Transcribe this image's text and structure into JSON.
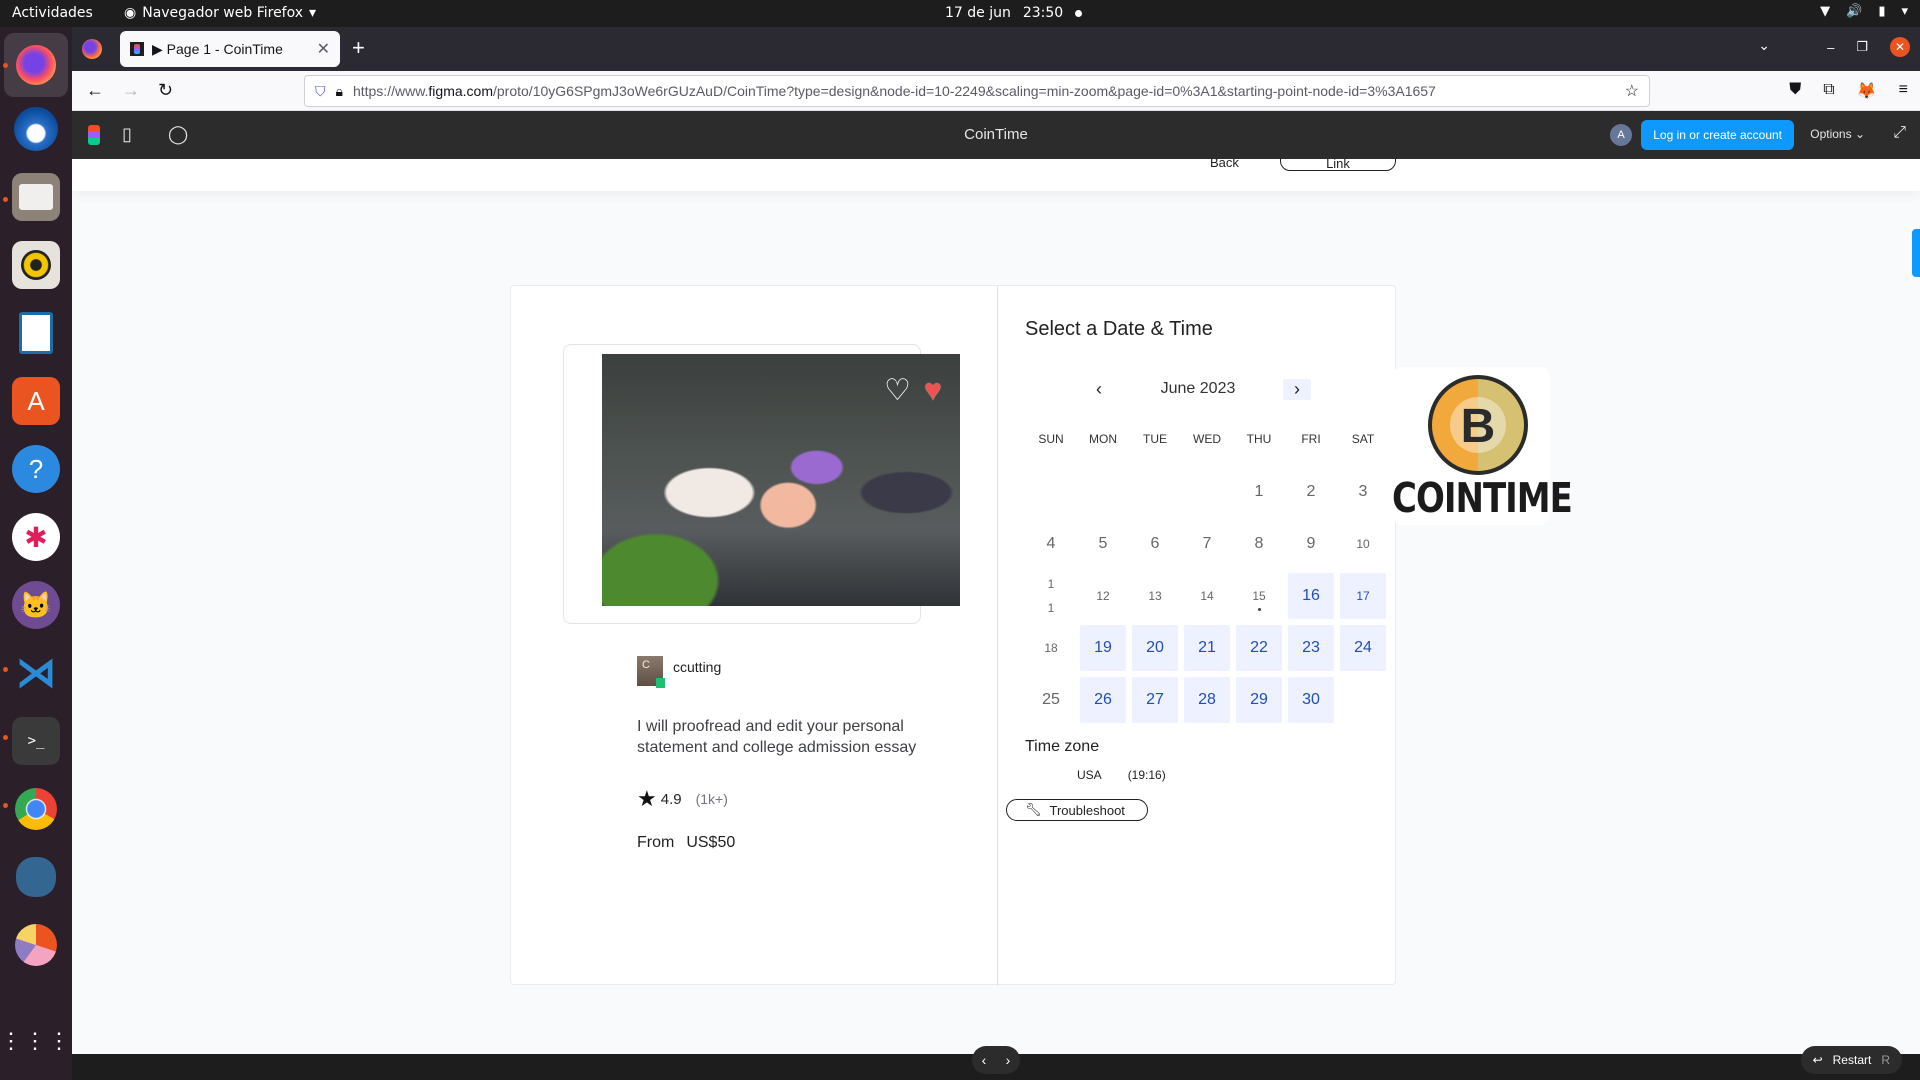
{
  "system": {
    "activities": "Actividades",
    "app_name": "Navegador web Firefox",
    "date": "17 de jun",
    "time": "23:50"
  },
  "dock": {
    "items": [
      "firefox",
      "thunderbird",
      "files",
      "rhythmbox",
      "libreoffice-writer",
      "app-center",
      "help",
      "slack",
      "github-desktop",
      "vscode",
      "terminal",
      "chrome",
      "pgadmin",
      "pie-chart-app",
      "show-apps"
    ]
  },
  "browser": {
    "tab_title": "▶ Page 1 - CoinTime",
    "url_prefix": "https://www.",
    "url_host": "figma.com",
    "url_path": "/proto/10yG6SPgmJ3oWe6rGUzAuD/CoinTime?type=design&node-id=10-2249&scaling=min-zoom&page-id=0%3A1&starting-point-node-id=3%3A1657"
  },
  "figma": {
    "title": "CoinTime",
    "avatar_initial": "A",
    "login_label": "Log in or create account",
    "options_label": "Options ⌄",
    "restart_label": "Restart",
    "restart_key": "R"
  },
  "strip": {
    "back_label": "Back",
    "link_label": "Link"
  },
  "gig": {
    "seller_initial": "C",
    "seller_name": "ccutting",
    "description": "I will proofread and edit your personal statement and college admission essay",
    "rating": "4.9",
    "rating_count": "(1k+)",
    "price_prefix": "From",
    "price": "US$50"
  },
  "calendar": {
    "title": "Select a Date & Time",
    "month": "June 2023",
    "prev_icon": "‹",
    "next_icon": "›",
    "weekdays": [
      "SUN",
      "MON",
      "TUE",
      "WED",
      "THU",
      "FRI",
      "SAT"
    ],
    "weeks": [
      [
        {
          "d": ""
        },
        {
          "d": ""
        },
        {
          "d": ""
        },
        {
          "d": ""
        },
        {
          "d": "1"
        },
        {
          "d": "2"
        },
        {
          "d": "3"
        }
      ],
      [
        {
          "d": "4"
        },
        {
          "d": "5"
        },
        {
          "d": "6"
        },
        {
          "d": "7"
        },
        {
          "d": "8"
        },
        {
          "d": "9"
        },
        {
          "d": "10",
          "small": true
        }
      ],
      [
        {
          "d": "1\n1",
          "small": true
        },
        {
          "d": "12",
          "small": true
        },
        {
          "d": "13",
          "small": true
        },
        {
          "d": "14",
          "small": true
        },
        {
          "d": "15",
          "small": true,
          "today": true
        },
        {
          "d": "16",
          "avail": true
        },
        {
          "d": "17",
          "avail": true,
          "small": true
        }
      ],
      [
        {
          "d": "18",
          "small": true
        },
        {
          "d": "19",
          "avail": true
        },
        {
          "d": "20",
          "avail": true
        },
        {
          "d": "21",
          "avail": true
        },
        {
          "d": "22",
          "avail": true
        },
        {
          "d": "23",
          "avail": true
        },
        {
          "d": "24",
          "avail": true
        }
      ],
      [
        {
          "d": "25"
        },
        {
          "d": "26",
          "avail": true
        },
        {
          "d": "27",
          "avail": true
        },
        {
          "d": "28",
          "avail": true
        },
        {
          "d": "29",
          "avail": true
        },
        {
          "d": "30",
          "avail": true
        },
        {
          "d": ""
        }
      ]
    ],
    "timezone_label": "Time zone",
    "timezone_region": "USA",
    "timezone_time": "(19:16)",
    "troubleshoot_label": "Troubleshoot"
  },
  "brand": {
    "wordmark": "COINTIME",
    "coin_letter": "B"
  },
  "colors": {
    "accent": "#0d99ff",
    "available_day_bg": "#eef1ff",
    "available_day_text": "#1f4fb8",
    "heart": "#ef5350",
    "online": "#1dbf73"
  }
}
